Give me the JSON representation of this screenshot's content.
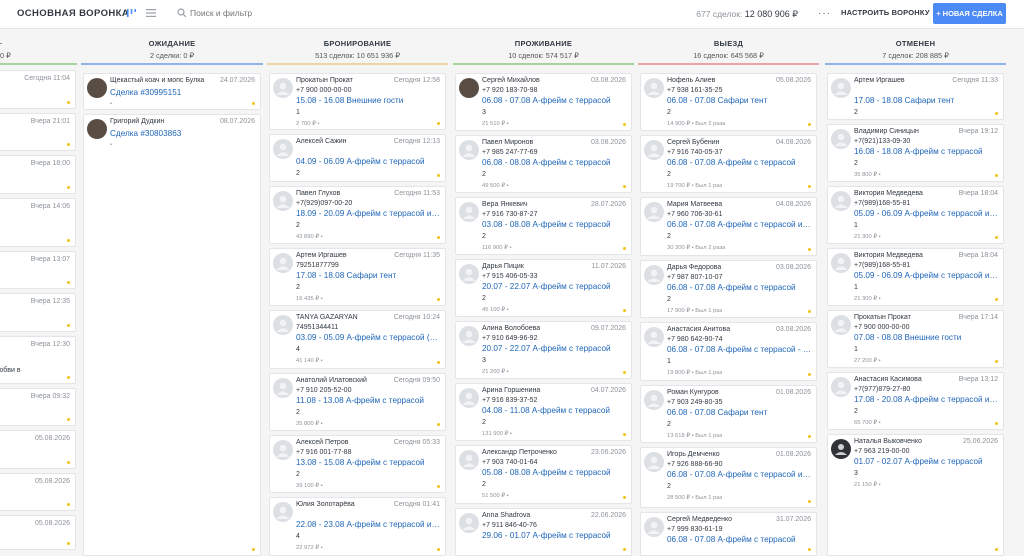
{
  "header": {
    "pipeline_title": "ОСНОВНАЯ ВОРОНКА",
    "search_placeholder": "Поиск и фильтр",
    "deals_count_label": "677 сделок:",
    "deals_total": "12 080 906 ₽",
    "more_icon": "more-dots-icon",
    "setup_label": "НАСТРОИТЬ ВОРОНКУ",
    "new_deal_label": "+ НОВАЯ СДЕЛКА",
    "accent_color": "#4c8bf5"
  },
  "left_partial": {
    "summary": "0 ₽",
    "cards": [
      {
        "when": "Сегодня 11:04",
        "name": ""
      },
      {
        "when": "Вчера 21:01",
        "name": ""
      },
      {
        "when": "Вчера 18:00",
        "name": ""
      },
      {
        "when": "Вчера 14:06",
        "name": ""
      },
      {
        "when": "Вчера 13:07",
        "name": ""
      },
      {
        "when": "Вчера 12:35",
        "name": ""
      },
      {
        "when": "Вчера 12:30",
        "name": "юбви в"
      },
      {
        "when": "Вчера 09:32",
        "name": ""
      },
      {
        "when": "05.08.2026",
        "name": ""
      },
      {
        "when": "05.08.2026",
        "name": ""
      },
      {
        "when": "05.08.2026",
        "name": ""
      }
    ]
  },
  "columns": [
    {
      "title": "ОЖИДАНИЕ",
      "summary": "2 сделки: 0 ₽",
      "line_color": "#8fb2e8",
      "cards": [
        {
          "avatar": "photo",
          "name": "Щекастый коач и мопс Булка",
          "when": "24.07.2026",
          "phone": "",
          "deal": "Сделка #30995151",
          "count": "",
          "price": "",
          "paid": ""
        },
        {
          "avatar": "photo",
          "name": "Григорий Дудкин",
          "when": "08.07.2026",
          "phone": "",
          "deal": "Сделка #30803863",
          "count": "",
          "price": "",
          "paid": ""
        }
      ]
    },
    {
      "title": "БРОНИРОВАНИЕ",
      "summary": "513 сделок: 10 651 936 ₽",
      "line_color": "#ecd6a0",
      "cards": [
        {
          "avatar": "",
          "name": "Прокатын Прокат",
          "when": "Сегодня 12:58",
          "phone": "+7 900 000-00-00",
          "deal": "15.08 - 16.08 Внешние гости",
          "count": "1",
          "price": "2 700 ₽",
          "paid": ""
        },
        {
          "avatar": "",
          "name": "Алексей Сажин",
          "when": "Сегодня 12:13",
          "phone": "",
          "deal": "04.09 - 06.09 А-фрейм с террасой",
          "count": "2",
          "price": "39 272 ₽",
          "paid": ""
        },
        {
          "avatar": "",
          "name": "Павел Глухов",
          "when": "Сегодня 11:53",
          "phone": "+7(929)097-00-20",
          "deal": "18.09 - 20.09 А-фрейм с террасой и к...",
          "count": "2",
          "price": "43 890 ₽",
          "paid": ""
        },
        {
          "avatar": "",
          "name": "Артем Иргашев",
          "when": "Сегодня 11:35",
          "phone": "79251877799",
          "deal": "17.08 - 18.08 Сафари тент",
          "count": "2",
          "price": "16 435 ₽",
          "paid": ""
        },
        {
          "avatar": "",
          "name": "TANYA GAZARYAN",
          "when": "Сегодня 10:24",
          "phone": "74951344411",
          "deal": "03.09 - 05.09 А-фрейм с террасой (до...",
          "count": "4",
          "price": "41 140 ₽",
          "paid": ""
        },
        {
          "avatar": "",
          "name": "Анатолий Илатовский",
          "when": "Сегодня 09:50",
          "phone": "+7 910 205-52-00",
          "deal": "11.08 - 13.08 А-фрейм с террасой",
          "count": "2",
          "price": "35 800 ₽",
          "paid": ""
        },
        {
          "avatar": "",
          "name": "Алексей Петров",
          "when": "Сегодня 05:33",
          "phone": "+7 916 001-77-88",
          "deal": "13.08 - 15.08 А-фрейм с террасой",
          "count": "2",
          "price": "39 100 ₽",
          "paid": ""
        },
        {
          "avatar": "",
          "name": "Юлия Золотарёва",
          "when": "Сегодня 01:41",
          "phone": "",
          "deal": "22.08 - 23.08 А-фрейм с террасой и к...",
          "count": "4",
          "price": "22 972 ₽",
          "paid": ""
        }
      ]
    },
    {
      "title": "ПРОЖИВАНИЕ",
      "summary": "10 сделок: 574 517 ₽",
      "line_color": "#a8d39e",
      "cards": [
        {
          "avatar": "photo",
          "name": "Сергей Михайлов",
          "when": "03.08.2026",
          "phone": "+7 920 183-70-98",
          "deal": "06.08 - 07.08 А-фрейм с террасой",
          "count": "3",
          "price": "21 510 ₽",
          "paid": ""
        },
        {
          "avatar": "",
          "name": "Павел Миронов",
          "when": "03.08.2026",
          "phone": "+7 985 247-77-69",
          "deal": "06.08 - 08.08 А-фрейм с террасой",
          "count": "2",
          "price": "49 500 ₽",
          "paid": ""
        },
        {
          "avatar": "",
          "name": "Вера Янкевич",
          "when": "28.07.2026",
          "phone": "+7 916 730-87-27",
          "deal": "03.08 - 08.08 А-фрейм с террасой",
          "count": "2",
          "price": "116 900 ₽",
          "paid": ""
        },
        {
          "avatar": "",
          "name": "Дарья Пицик",
          "when": "11.07.2026",
          "phone": "+7 915 406-05-33",
          "deal": "20.07 - 22.07 А-фрейм с террасой",
          "count": "2",
          "price": "45 100 ₽",
          "paid": ""
        },
        {
          "avatar": "",
          "name": "Алина Волобоева",
          "when": "09.07.2026",
          "phone": "+7 910 649-96-92",
          "deal": "20.07 - 22.07 А-фрейм с террасой",
          "count": "3",
          "price": "21 200 ₽",
          "paid": ""
        },
        {
          "avatar": "",
          "name": "Арина Горшенина",
          "when": "04.07.2026",
          "phone": "+7 916 839-37-52",
          "deal": "04.08 - 11.08 А-фрейм с террасой",
          "count": "2",
          "price": "131 900 ₽",
          "paid": ""
        },
        {
          "avatar": "",
          "name": "Александр Петроченко",
          "when": "23.06.2026",
          "phone": "+7 903 740-01-64",
          "deal": "05.08 - 08.08 А-фрейм с террасой",
          "count": "2",
          "price": "51 500 ₽",
          "paid": ""
        },
        {
          "avatar": "",
          "name": "Anna Shadrova",
          "when": "22.06.2026",
          "phone": "+7 911 846-40-76",
          "deal": "29.06 - 01.07 А-фрейм с террасой",
          "count": "",
          "price": "",
          "paid": ""
        }
      ]
    },
    {
      "title": "ВЫЕЗД",
      "summary": "16 сделок: 645 568 ₽",
      "line_color": "#e9a5a5",
      "cards": [
        {
          "avatar": "",
          "name": "Нофель Алиев",
          "when": "05.08.2026",
          "phone": "+7 938 161-35-25",
          "deal": "06.08 - 07.08 Сафари тент",
          "count": "2",
          "price": "14 900 ₽",
          "paid": "Был 2 раза"
        },
        {
          "avatar": "",
          "name": "Сергей Бубенин",
          "when": "04.08.2026",
          "phone": "+7 916 740-05-37",
          "deal": "06.08 - 07.08 А-фрейм с террасой",
          "count": "2",
          "price": "19 700 ₽",
          "paid": "Был 1 раз"
        },
        {
          "avatar": "",
          "name": "Мария Матвеева",
          "when": "04.08.2026",
          "phone": "+7 960 706-30-61",
          "deal": "06.08 - 07.08 А-фрейм с террасой и к...",
          "count": "2",
          "price": "30 300 ₽",
          "paid": "Был 2 раза"
        },
        {
          "avatar": "",
          "name": "Дарья Федорова",
          "when": "03.08.2026",
          "phone": "+7 987 807-10-07",
          "deal": "06.08 - 07.08 А-фрейм с террасой",
          "count": "2",
          "price": "17 900 ₽",
          "paid": "Был 1 раз"
        },
        {
          "avatar": "",
          "name": "Анастасия Анитова",
          "when": "03.08.2026",
          "phone": "+7 980 642-90-74",
          "deal": "06.08 - 07.08 А-фрейм с террасой - 1 ...",
          "count": "1",
          "price": "19 800 ₽",
          "paid": "Был 1 раз"
        },
        {
          "avatar": "",
          "name": "Роман Кунгуров",
          "when": "01.08.2026",
          "phone": "+7 903 249-80-35",
          "deal": "06.08 - 07.08 Сафари тент",
          "count": "2",
          "price": "13 618 ₽",
          "paid": "Был 1 раз"
        },
        {
          "avatar": "",
          "name": "Игорь Демченко",
          "when": "01.08.2026",
          "phone": "+7 926 888-66-90",
          "deal": "06.08 - 07.08 А-фрейм с террасой и к...",
          "count": "2",
          "price": "28 500 ₽",
          "paid": "Был 1 раз"
        },
        {
          "avatar": "",
          "name": "Сергей Медведенко",
          "when": "31.07.2026",
          "phone": "+7 999 830-61-19",
          "deal": "06.08 - 07.08 А-фрейм с террасой",
          "count": "",
          "price": "",
          "paid": ""
        }
      ]
    },
    {
      "title": "ОТМЕНЕН",
      "summary": "7 сделок: 208 885 ₽",
      "line_color": "#8fb2e8",
      "cards": [
        {
          "avatar": "",
          "name": "Артем Иргашев",
          "when": "Сегодня 11:33",
          "phone": "",
          "deal": "17.08 - 18.08 Сафари тент",
          "count": "2",
          "price": "16 435 ₽",
          "paid": ""
        },
        {
          "avatar": "",
          "name": "Владимир Синицын",
          "when": "Вчера 19:12",
          "phone": "+7(921)133-09-30",
          "deal": "16.08 - 18.08 А-фрейм с террасой",
          "count": "2",
          "price": "35 800 ₽",
          "paid": ""
        },
        {
          "avatar": "",
          "name": "Виктория Медведева",
          "when": "Вчера 18:04",
          "phone": "+7(989)168-55-81",
          "deal": "05.09 - 06.09 А-фрейм с террасой и к...",
          "count": "1",
          "price": "21 300 ₽",
          "paid": ""
        },
        {
          "avatar": "",
          "name": "Виктория Медведева",
          "when": "Вчера 18:04",
          "phone": "+7(989)168-55-81",
          "deal": "05.09 - 06.09 А-фрейм с террасой и к...",
          "count": "1",
          "price": "21 300 ₽",
          "paid": ""
        },
        {
          "avatar": "",
          "name": "Прокатын Прокат",
          "when": "Вчера 17:14",
          "phone": "+7 900 000-00-00",
          "deal": "07.08 - 08.08 Внешние гости",
          "count": "1",
          "price": "27 200 ₽",
          "paid": ""
        },
        {
          "avatar": "",
          "name": "Анастасия Касимова",
          "when": "Вчера 13:12",
          "phone": "+7(977)879-27-80",
          "deal": "17.08 - 20.08 А-фрейм с террасой и к...",
          "count": "2",
          "price": "65 700 ₽",
          "paid": ""
        },
        {
          "avatar": "dark",
          "name": "Наталья Выковченко",
          "when": "25.06.2026",
          "phone": "+7 963 219-00-00",
          "deal": "01.07 - 02.07 А-фрейм с террасой",
          "count": "3",
          "price": "21 150 ₽",
          "paid": ""
        }
      ]
    }
  ]
}
